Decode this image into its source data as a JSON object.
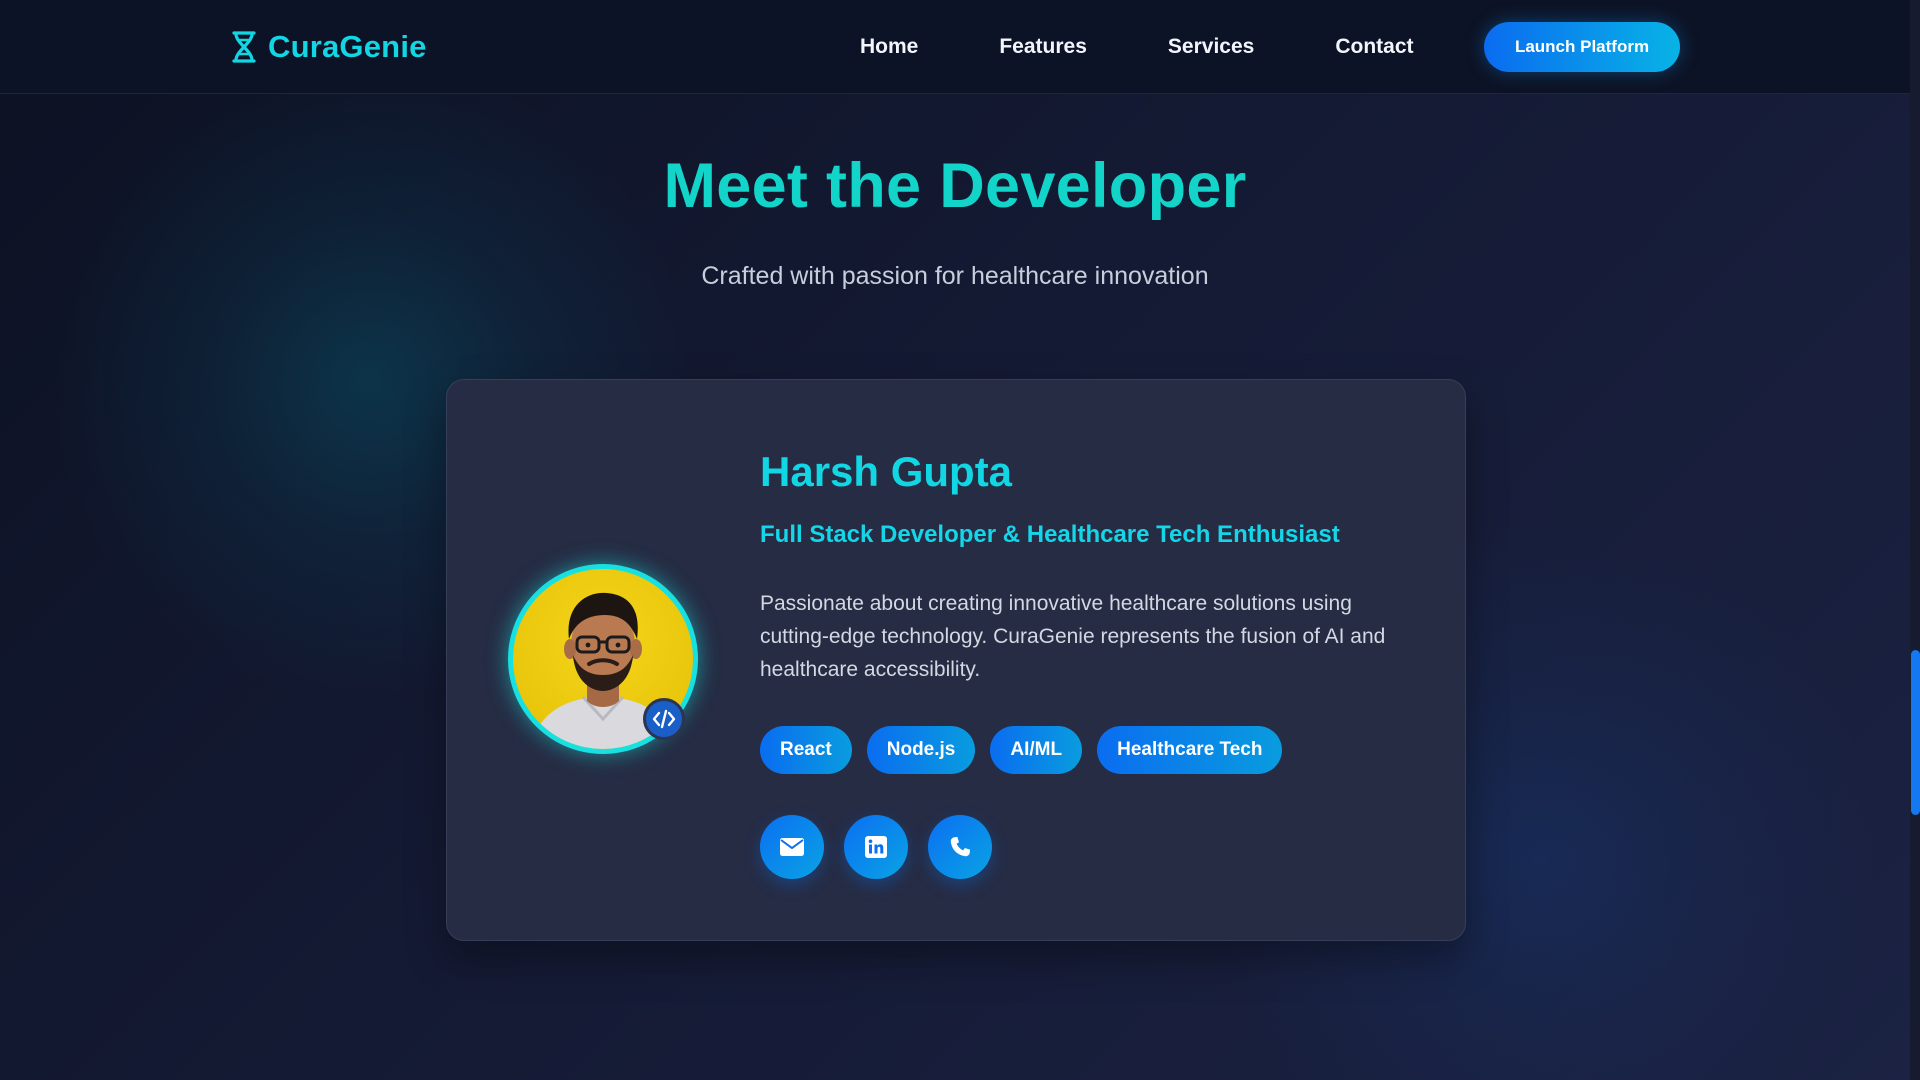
{
  "navbar": {
    "brand": "CuraGenie",
    "brand_icon": "dna-icon",
    "links": [
      "Home",
      "Features",
      "Services",
      "Contact"
    ],
    "cta": "Launch Platform"
  },
  "section": {
    "title": "Meet the Developer",
    "subtitle": "Crafted with passion for healthcare innovation"
  },
  "developer": {
    "name": "Harsh Gupta",
    "role": "Full Stack Developer & Healthcare Tech Enthusiast",
    "bio": "Passionate about creating innovative healthcare solutions using cutting-edge technology. CuraGenie represents the fusion of AI and healthcare accessibility.",
    "avatar_badge_icon": "code-icon",
    "skills": [
      "React",
      "Node.js",
      "AI/ML",
      "Healthcare Tech"
    ],
    "contacts": [
      {
        "icon": "envelope-icon"
      },
      {
        "icon": "linkedin-icon"
      },
      {
        "icon": "phone-icon"
      }
    ]
  },
  "colors": {
    "accent_cyan": "#12d6e3",
    "accent_blue": "#0a6cf0",
    "background": "#0f1427",
    "card": "#252c43"
  }
}
